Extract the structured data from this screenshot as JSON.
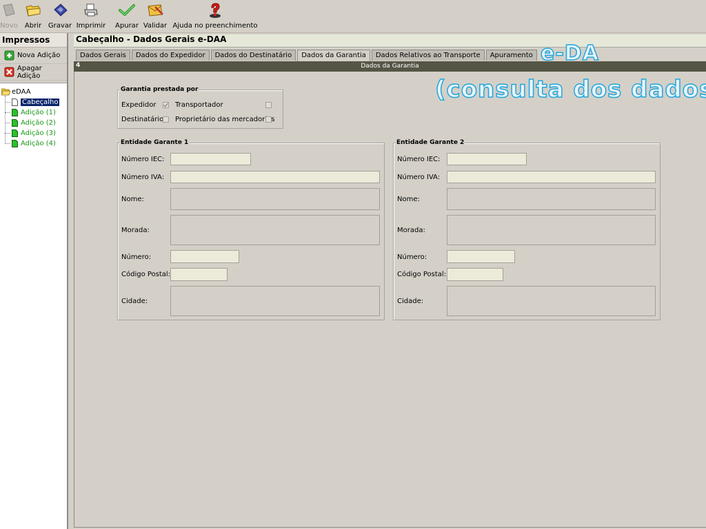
{
  "toolbar": {
    "novo": "Novo",
    "abrir": "Abrir",
    "gravar": "Gravar",
    "imprimir": "Imprimir",
    "apurar": "Apurar",
    "validar": "Validar",
    "ajuda": "Ajuda no preenchimento"
  },
  "left": {
    "title": "Impressos",
    "nova_adicao": "Nova Adição",
    "apagar_adicao": "Apagar Adição",
    "tree": {
      "root": "eDAA",
      "children": [
        "Cabeçalho",
        "Adição (1)",
        "Adição (2)",
        "Adição (3)",
        "Adição (4)"
      ]
    }
  },
  "main": {
    "title": "Cabeçalho - Dados Gerais e-DAA",
    "tabs": [
      "Dados Gerais",
      "Dados do Expedidor",
      "Dados do Destinatário",
      "Dados da Garantia",
      "Dados Relativos ao Transporte",
      "Apuramento"
    ],
    "active_tab": "Dados da Garantia",
    "strip_number": "4",
    "strip_title": "Dados da Garantia"
  },
  "garantia": {
    "title": "Garantia prestada por",
    "expedidor": "Expedidor",
    "expedidor_checked": true,
    "transportador": "Transportador",
    "transportador_checked": false,
    "destinatario": "Destinatário",
    "destinatario_checked": false,
    "proprietario": "Proprietário das mercadorias",
    "proprietario_checked": false
  },
  "entidade1": {
    "title": "Entidade Garante 1",
    "iec": "Número IEC:",
    "iva": "Número IVA:",
    "nome": "Nome:",
    "morada": "Morada:",
    "numero": "Número:",
    "codigo_postal": "Código Postal:",
    "cidade": "Cidade:"
  },
  "entidade2": {
    "title": "Entidade Garante 2",
    "iec": "Número IEC:",
    "iva": "Número IVA:",
    "nome": "Nome:",
    "morada": "Morada:",
    "numero": "Número:",
    "codigo_postal": "Código Postal:",
    "cidade": "Cidade:"
  },
  "overlay": {
    "line1": "e-DA",
    "line2": "(consulta dos dados)"
  },
  "colors": {
    "selection": "#0a246a",
    "tree_green": "#1a9a1a",
    "strip": "#555545",
    "overlay_outline": "#22a6dc"
  }
}
